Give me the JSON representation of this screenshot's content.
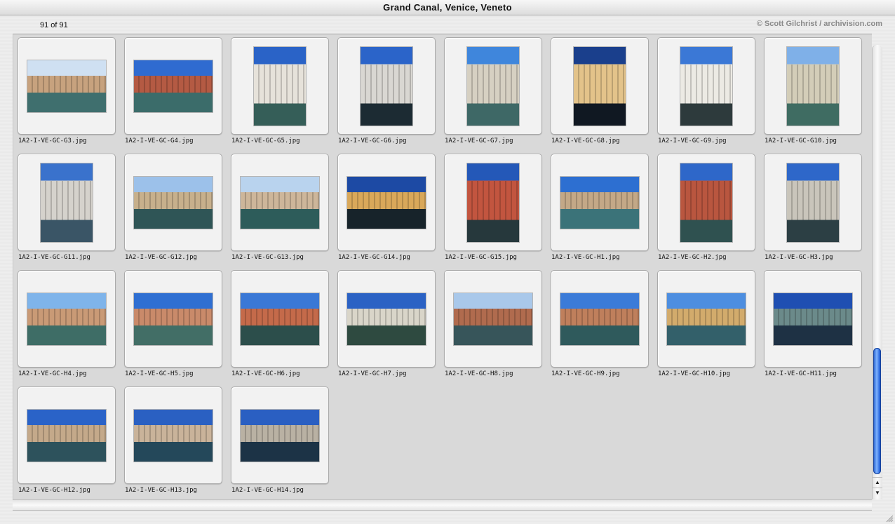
{
  "window": {
    "title": "Grand Canal, Venice, Veneto"
  },
  "toolbar": {
    "count": "91 of 91",
    "copyright": "© Scott Gilchrist / archivision.com"
  },
  "scrollbar": {
    "up_arrow": "▲",
    "down_arrow": "▼"
  },
  "thumbnails": [
    {
      "caption": "1A2-I-VE-GC-G3.jpg",
      "orientation": "landscape",
      "sky": "#cfe0f2",
      "water": "#3f6f6e",
      "building": "#c7a27e"
    },
    {
      "caption": "1A2-I-VE-GC-G4.jpg",
      "orientation": "landscape",
      "sky": "#2f6bd0",
      "water": "#3b6c6a",
      "building": "#b45a43"
    },
    {
      "caption": "1A2-I-VE-GC-G5.jpg",
      "orientation": "portrait",
      "sky": "#2a63c7",
      "water": "#355e58",
      "building": "#e6e2da"
    },
    {
      "caption": "1A2-I-VE-GC-G6.jpg",
      "orientation": "portrait",
      "sky": "#2b64c9",
      "water": "#1c2b33",
      "building": "#d9d7d2"
    },
    {
      "caption": "1A2-I-VE-GC-G7.jpg",
      "orientation": "portrait",
      "sky": "#3f86dc",
      "water": "#3e6866",
      "building": "#d6d0c2"
    },
    {
      "caption": "1A2-I-VE-GC-G8.jpg",
      "orientation": "portrait",
      "sky": "#1a3f8c",
      "water": "#101822",
      "building": "#e3c38a"
    },
    {
      "caption": "1A2-I-VE-GC-G9.jpg",
      "orientation": "portrait",
      "sky": "#3b78d6",
      "water": "#2d3a3c",
      "building": "#eceae4"
    },
    {
      "caption": "1A2-I-VE-GC-G10.jpg",
      "orientation": "portrait",
      "sky": "#7fb0e8",
      "water": "#3f6c62",
      "building": "#d3cdb8"
    },
    {
      "caption": "1A2-I-VE-GC-G11.jpg",
      "orientation": "portrait",
      "sky": "#3a72cc",
      "water": "#3a5566",
      "building": "#d5d2cc"
    },
    {
      "caption": "1A2-I-VE-GC-G12.jpg",
      "orientation": "landscape",
      "sky": "#9cc1ea",
      "water": "#2f5556",
      "building": "#c7b08c"
    },
    {
      "caption": "1A2-I-VE-GC-G13.jpg",
      "orientation": "landscape",
      "sky": "#b9d3ee",
      "water": "#2d5c5a",
      "building": "#cdb69a"
    },
    {
      "caption": "1A2-I-VE-GC-G14.jpg",
      "orientation": "landscape",
      "sky": "#1d4aa4",
      "water": "#17232a",
      "building": "#d9a85a"
    },
    {
      "caption": "1A2-I-VE-GC-G15.jpg",
      "orientation": "portrait",
      "sky": "#2458b8",
      "water": "#26383c",
      "building": "#c2553f"
    },
    {
      "caption": "1A2-I-VE-GC-H1.jpg",
      "orientation": "landscape",
      "sky": "#2d6fd1",
      "water": "#3b7379",
      "building": "#c3a887"
    },
    {
      "caption": "1A2-I-VE-GC-H2.jpg",
      "orientation": "portrait",
      "sky": "#2e67c9",
      "water": "#2f5150",
      "building": "#b9563f"
    },
    {
      "caption": "1A2-I-VE-GC-H3.jpg",
      "orientation": "portrait",
      "sky": "#2e67c9",
      "water": "#2c3f44",
      "building": "#c9c5bb"
    },
    {
      "caption": "1A2-I-VE-GC-H4.jpg",
      "orientation": "landscape",
      "sky": "#7fb4ea",
      "water": "#3e6d66",
      "building": "#c99a76"
    },
    {
      "caption": "1A2-I-VE-GC-H5.jpg",
      "orientation": "landscape",
      "sky": "#2f6fd2",
      "water": "#426e66",
      "building": "#c98a6a"
    },
    {
      "caption": "1A2-I-VE-GC-H6.jpg",
      "orientation": "landscape",
      "sky": "#3a78d6",
      "water": "#2c4e4b",
      "building": "#c46a4a"
    },
    {
      "caption": "1A2-I-VE-GC-H7.jpg",
      "orientation": "landscape",
      "sky": "#2b62c4",
      "water": "#2e4a40",
      "building": "#d9d5c9"
    },
    {
      "caption": "1A2-I-VE-GC-H8.jpg",
      "orientation": "landscape",
      "sky": "#a9c8ea",
      "water": "#37555a",
      "building": "#b06b4e"
    },
    {
      "caption": "1A2-I-VE-GC-H9.jpg",
      "orientation": "landscape",
      "sky": "#3b7bd8",
      "water": "#2f5a5c",
      "building": "#bf7f5c"
    },
    {
      "caption": "1A2-I-VE-GC-H10.jpg",
      "orientation": "landscape",
      "sky": "#4d8ee0",
      "water": "#33606a",
      "building": "#d2ab6c"
    },
    {
      "caption": "1A2-I-VE-GC-H11.jpg",
      "orientation": "landscape",
      "sky": "#1f4fb2",
      "water": "#1e3144",
      "building": "#6b8a8a"
    },
    {
      "caption": "1A2-I-VE-GC-H12.jpg",
      "orientation": "landscape",
      "sky": "#2a63c8",
      "water": "#2d525c",
      "building": "#c4a98a"
    },
    {
      "caption": "1A2-I-VE-GC-H13.jpg",
      "orientation": "landscape",
      "sky": "#2a60c2",
      "water": "#24485a",
      "building": "#c9b39a"
    },
    {
      "caption": "1A2-I-VE-GC-H14.jpg",
      "orientation": "landscape",
      "sky": "#2a5fc2",
      "water": "#1c3346",
      "building": "#b9b1a3"
    }
  ]
}
